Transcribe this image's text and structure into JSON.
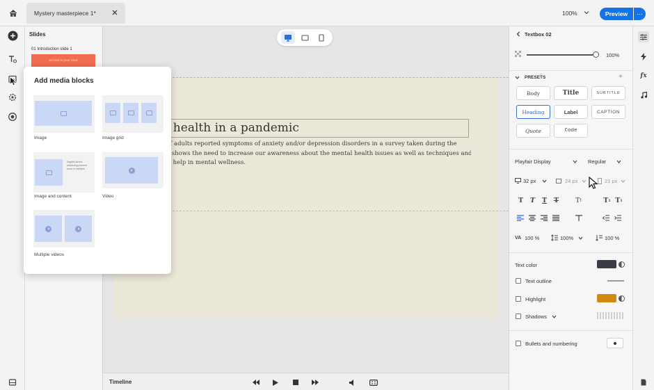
{
  "topbar": {
    "document_tab": "Mystery masterpiece 1*",
    "zoom": "100%",
    "preview_label": "Preview",
    "more_label": "···"
  },
  "slides_panel": {
    "title": "Slides",
    "slides": [
      {
        "label": "01  Introduction slide 1",
        "thumb_text": "Be kind to your mind"
      }
    ]
  },
  "media_popup": {
    "title": "Add media blocks",
    "items": [
      {
        "label": "Image"
      },
      {
        "label": "Image grid"
      },
      {
        "label": "Image and content",
        "preview_text": "Sagittis lacitus adipiscing posuere lacus et habitant"
      },
      {
        "label": "Video"
      },
      {
        "label": "Multiple videos"
      }
    ]
  },
  "slide": {
    "heading": "tal health in a pandemic",
    "body_lines": [
      "s of adults reported symptoms of anxiety and/or depression disorders in a survey taken during the",
      ". It shows the need to increase our awareness about the mental health issues as well as techniques and",
      "hat help in mental wellness."
    ]
  },
  "timeline": {
    "label": "Timeline"
  },
  "properties": {
    "panel_title": "Textbox 02",
    "opacity": "100%",
    "presets_title": "PRESETS",
    "presets": [
      "Body",
      "Title",
      "SUBTITLE",
      "Heading",
      "Label",
      "CAPTION",
      "Quote",
      "Code"
    ],
    "selected_preset": "Heading",
    "font_family": "Playfair Display",
    "font_weight": "Regular",
    "size_desktop": "32 px",
    "size_tablet": "24 px",
    "size_mobile": "21 px",
    "character_spacing": "100 %",
    "line_spacing": "100%",
    "paragraph_spacing": "100 %",
    "text_color_label": "Text color",
    "text_outline_label": "Text outline",
    "highlight_label": "Highlight",
    "shadows_label": "Shadows",
    "bullets_label": "Bullets and numbering",
    "text_color": "#3a3d45",
    "highlight_color": "#d08a12"
  },
  "colors": {
    "accent": "#1473e6",
    "slide_background": "#ece8d9",
    "thumb_red": "#f26c4f"
  }
}
